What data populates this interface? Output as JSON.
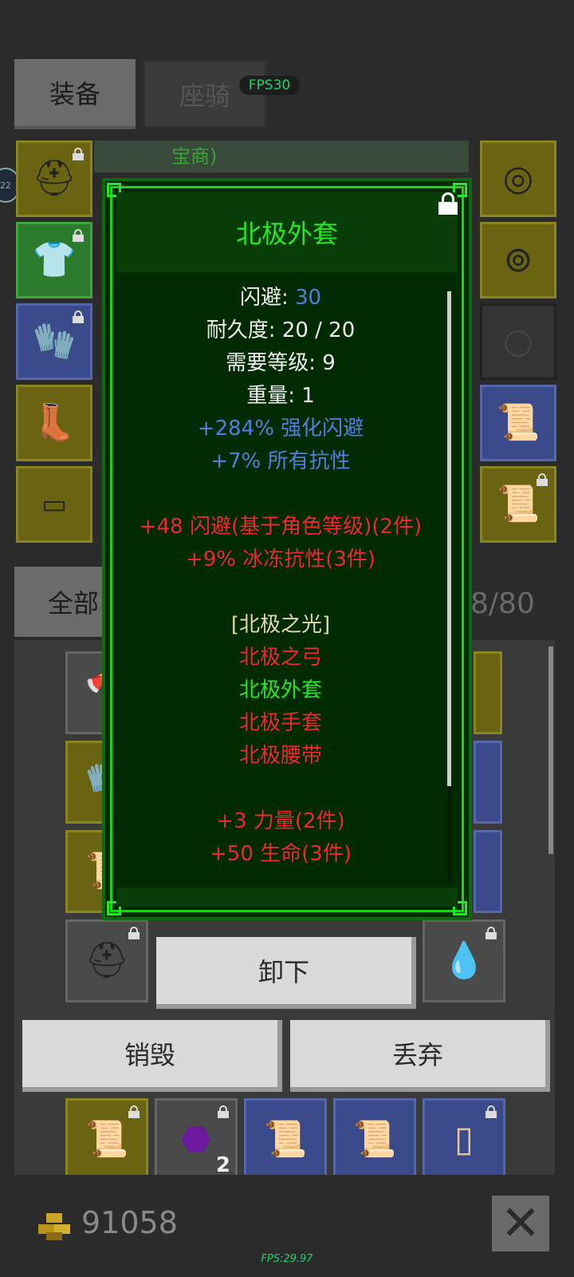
{
  "tabs": {
    "equipment": "装备",
    "mount": "座骑"
  },
  "fps_badge": "FPS30",
  "avatar_level": "22",
  "bg_text": "宝商)",
  "filter": {
    "label": "全部",
    "capacity": "8/80"
  },
  "popup": {
    "title": "北极外套",
    "lines": [
      {
        "segments": [
          {
            "text": "闪避: ",
            "color": "w"
          },
          {
            "text": "30",
            "color": "b"
          }
        ]
      },
      {
        "segments": [
          {
            "text": "耐久度: 20 / 20",
            "color": "w"
          }
        ]
      },
      {
        "segments": [
          {
            "text": "需要等级: 9",
            "color": "w"
          }
        ]
      },
      {
        "segments": [
          {
            "text": "重量: 1",
            "color": "w"
          }
        ]
      },
      {
        "segments": [
          {
            "text": "+284% 强化闪避",
            "color": "b"
          }
        ]
      },
      {
        "segments": [
          {
            "text": "+7% 所有抗性",
            "color": "b"
          }
        ]
      },
      {
        "segments": [
          {
            "text": "",
            "color": "w"
          }
        ]
      },
      {
        "segments": [
          {
            "text": "+48 闪避(基于角色等级)(2件)",
            "color": "r"
          }
        ]
      },
      {
        "segments": [
          {
            "text": "+9% 冰冻抗性(3件)",
            "color": "r"
          }
        ]
      },
      {
        "segments": [
          {
            "text": "",
            "color": "w"
          }
        ]
      },
      {
        "segments": [
          {
            "text": "[北极之光]",
            "color": "y"
          }
        ]
      },
      {
        "segments": [
          {
            "text": "北极之弓",
            "color": "r"
          }
        ]
      },
      {
        "segments": [
          {
            "text": "北极外套",
            "color": "g"
          }
        ]
      },
      {
        "segments": [
          {
            "text": "北极手套",
            "color": "r"
          }
        ]
      },
      {
        "segments": [
          {
            "text": "北极腰带",
            "color": "r"
          }
        ]
      },
      {
        "segments": [
          {
            "text": "",
            "color": "w"
          }
        ]
      },
      {
        "segments": [
          {
            "text": "+3 力量(2件)",
            "color": "r"
          }
        ]
      },
      {
        "segments": [
          {
            "text": "+50 生命(3件)",
            "color": "r"
          }
        ]
      }
    ]
  },
  "actions": {
    "unequip": "卸下",
    "destroy": "销毁",
    "drop": "丢弃"
  },
  "inventory_count": "2",
  "gold": "91058",
  "fps_footer": "FPS:29.97",
  "colors": {
    "popup_bg": "#002a00",
    "popup_border": "#1ecf1e",
    "title": "#2ae62a",
    "red": "#f02828",
    "blue": "#4d7fe0"
  }
}
